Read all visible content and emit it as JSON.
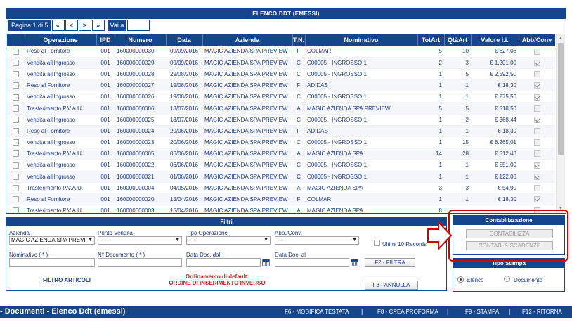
{
  "ddt_panel": {
    "title": "ELENCO DDT (EMESSI)",
    "pager_label": "Pagina 1 di 5",
    "btn_first": "«",
    "btn_prev": "<",
    "btn_next": ">",
    "btn_last": "»",
    "goto_label": "Vai a",
    "goto_value": ""
  },
  "table": {
    "columns": [
      "",
      "Operazione",
      "IPD",
      "Numero",
      "Data",
      "Azienda",
      "T.N.",
      "Nominativo",
      "TotArt",
      "QtàArt",
      "Valore i.i.",
      "Abb/Conv"
    ],
    "rows": [
      {
        "op": "Reso al Fornitore",
        "ipd": "001",
        "num": "160000000030",
        "data": "09/09/2016",
        "azienda": "MAGIC AZIENDA SPA PREVIEW",
        "tn": "F",
        "nom": "COLMAR",
        "totart": "5",
        "qtaart": "10",
        "valore": "€ 627,08",
        "abb": false,
        "abb_enabled": false
      },
      {
        "op": "Vendita all'Ingrosso",
        "ipd": "001",
        "num": "160000000029",
        "data": "09/09/2016",
        "azienda": "MAGIC AZIENDA SPA PREVIEW",
        "tn": "C",
        "nom": "C00005 - INGROSSO 1",
        "totart": "2",
        "qtaart": "3",
        "valore": "€ 1.201,00",
        "abb": true,
        "abb_enabled": false
      },
      {
        "op": "Vendita all'Ingrosso",
        "ipd": "001",
        "num": "160000000028",
        "data": "29/08/2016",
        "azienda": "MAGIC AZIENDA SPA PREVIEW",
        "tn": "C",
        "nom": "C00005 - INGROSSO 1",
        "totart": "1",
        "qtaart": "5",
        "valore": "€ 2.592,50",
        "abb": false,
        "abb_enabled": false
      },
      {
        "op": "Reso al Fornitore",
        "ipd": "001",
        "num": "160000000027",
        "data": "19/08/2016",
        "azienda": "MAGIC AZIENDA SPA PREVIEW",
        "tn": "F",
        "nom": "ADIDAS",
        "totart": "1",
        "qtaart": "1",
        "valore": "€ 18,30",
        "abb": true,
        "abb_enabled": false
      },
      {
        "op": "Vendita all'Ingrosso",
        "ipd": "001",
        "num": "160000000026",
        "data": "19/08/2016",
        "azienda": "MAGIC AZIENDA SPA PREVIEW",
        "tn": "C",
        "nom": "C00005 - INGROSSO 1",
        "totart": "1",
        "qtaart": "1",
        "valore": "€ 275,50",
        "abb": true,
        "abb_enabled": false
      },
      {
        "op": "Trasferimento P.V.A.U.",
        "ipd": "001",
        "num": "160000000006",
        "data": "13/07/2016",
        "azienda": "MAGIC AZIENDA SPA PREVIEW",
        "tn": "A",
        "nom": "MAGIC AZIENDA SPA PREVIEW",
        "totart": "5",
        "qtaart": "5",
        "valore": "€ 518,50",
        "abb": false,
        "abb_enabled": false
      },
      {
        "op": "Vendita all'Ingrosso",
        "ipd": "001",
        "num": "160000000025",
        "data": "13/07/2016",
        "azienda": "MAGIC AZIENDA SPA PREVIEW",
        "tn": "C",
        "nom": "C00005 - INGROSSO 1",
        "totart": "1",
        "qtaart": "2",
        "valore": "€ 368,44",
        "abb": true,
        "abb_enabled": false
      },
      {
        "op": "Reso al Fornitore",
        "ipd": "001",
        "num": "160000000024",
        "data": "20/06/2016",
        "azienda": "MAGIC AZIENDA SPA PREVIEW",
        "tn": "F",
        "nom": "ADIDAS",
        "totart": "1",
        "qtaart": "1",
        "valore": "€ 18,30",
        "abb": false,
        "abb_enabled": false
      },
      {
        "op": "Vendita all'Ingrosso",
        "ipd": "001",
        "num": "160000000023",
        "data": "20/06/2016",
        "azienda": "MAGIC AZIENDA SPA PREVIEW",
        "tn": "C",
        "nom": "C00005 - INGROSSO 1",
        "totart": "1",
        "qtaart": "15",
        "valore": "€ 8.265,01",
        "abb": false,
        "abb_enabled": false
      },
      {
        "op": "Trasferimento P.V.A.U.",
        "ipd": "001",
        "num": "160000000005",
        "data": "06/06/2016",
        "azienda": "MAGIC AZIENDA SPA PREVIEW",
        "tn": "A",
        "nom": "MAGIC AZIENDA SPA",
        "totart": "14",
        "qtaart": "28",
        "valore": "€ 512,40",
        "abb": false,
        "abb_enabled": false
      },
      {
        "op": "Vendita all'Ingrosso",
        "ipd": "001",
        "num": "160000000022",
        "data": "06/06/2016",
        "azienda": "MAGIC AZIENDA SPA PREVIEW",
        "tn": "C",
        "nom": "C00005 - INGROSSO 1",
        "totart": "1",
        "qtaart": "1",
        "valore": "€ 551,00",
        "abb": true,
        "abb_enabled": false
      },
      {
        "op": "Vendita all'Ingrosso",
        "ipd": "001",
        "num": "160000000021",
        "data": "01/06/2016",
        "azienda": "MAGIC AZIENDA SPA PREVIEW",
        "tn": "C",
        "nom": "C00005 - INGROSSO 1",
        "totart": "1",
        "qtaart": "1",
        "valore": "€ 122,00",
        "abb": true,
        "abb_enabled": false
      },
      {
        "op": "Trasferimento P.V.A.U.",
        "ipd": "001",
        "num": "160000000004",
        "data": "04/05/2016",
        "azienda": "MAGIC AZIENDA SPA PREVIEW",
        "tn": "A",
        "nom": "MAGIC AZIENDA SPA",
        "totart": "3",
        "qtaart": "3",
        "valore": "€ 54,90",
        "abb": false,
        "abb_enabled": false
      },
      {
        "op": "Reso al Fornitore",
        "ipd": "001",
        "num": "160000000020",
        "data": "15/04/2016",
        "azienda": "MAGIC AZIENDA SPA PREVIEW",
        "tn": "F",
        "nom": "COLMAR",
        "totart": "1",
        "qtaart": "1",
        "valore": "€ 18,30",
        "abb": true,
        "abb_enabled": false
      },
      {
        "op": "Trasferimento P.V.A.U.",
        "ipd": "001",
        "num": "160000000003",
        "data": "15/04/2016",
        "azienda": "MAGIC AZIENDA SPA PREVIEW",
        "tn": "A",
        "nom": "MAGIC AZIENDA SPA",
        "totart": "8",
        "qtaart": "",
        "valore": "",
        "abb": false,
        "abb_enabled": false
      }
    ]
  },
  "filters": {
    "title": "Filtri",
    "azienda_label": "Azienda",
    "azienda_value": "MAGIC AZIENDA SPA PREVI",
    "pv_label": "Punto Vendita",
    "pv_value": "- - -",
    "tipo_op_label": "Tipo Operazione",
    "tipo_op_value": "- - -",
    "abb_label": "Abb./Conv.",
    "abb_value": "- - -",
    "ultimi_label": "Ultimi 10 Records",
    "nominativo_label": "Nominativo ( * )",
    "numdoc_label": "N° Documento ( * )",
    "data_dal_label": "Data Doc. dal",
    "data_al_label": "Data Doc. al",
    "btn_filtra": "F2 - FILTRA",
    "btn_annulla": "F3 - ANNULLA",
    "filtro_articoli": "FILTRO ARTICOLI",
    "ordinamento_line1": "Ordinamento di default:",
    "ordinamento_line2": "ORDINE DI INSERIMENTO INVERSO"
  },
  "contab": {
    "title": "Contabilizzazione",
    "btn_contabilizza": "CONTABILIZZA",
    "btn_scadenze": "CONTAB. & SCADENZE"
  },
  "tipo_stampa": {
    "title": "Tipo Stampa",
    "opt_elenco": "Elenco",
    "opt_documento": "Documento",
    "selected": "Elenco"
  },
  "bottom_bar": {
    "title": "- Documenti - Elenco Ddt (emessi)",
    "f6": "F6 - MODIFICA TESTATA",
    "f8": "F8 - CREA PROFORMA",
    "f9": "F9 - STAMPA",
    "f12": "F12 - RITORNA"
  },
  "colors": {
    "primary": "#15458c",
    "highlight_red": "#d50000",
    "text_blue": "#1e3a8a",
    "text_red": "#d32222"
  }
}
